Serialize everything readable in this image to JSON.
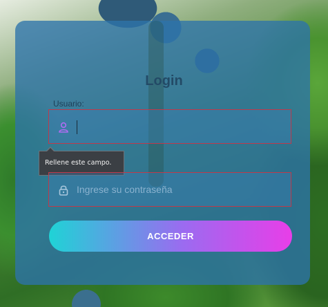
{
  "login": {
    "title": "Login",
    "username_label": "Usuario:",
    "username_value": "",
    "username_icon": "user-icon",
    "password_placeholder": "Ingrese su contraseña",
    "password_icon": "lock-icon",
    "tooltip": "Rellene este campo.",
    "submit_label": "ACCEDER"
  },
  "colors": {
    "card": "#2d73aa",
    "field_border": "#c0394a",
    "button_start": "#1fd3d6",
    "button_end": "#e83ee8",
    "user_icon": "#b06cf2"
  }
}
